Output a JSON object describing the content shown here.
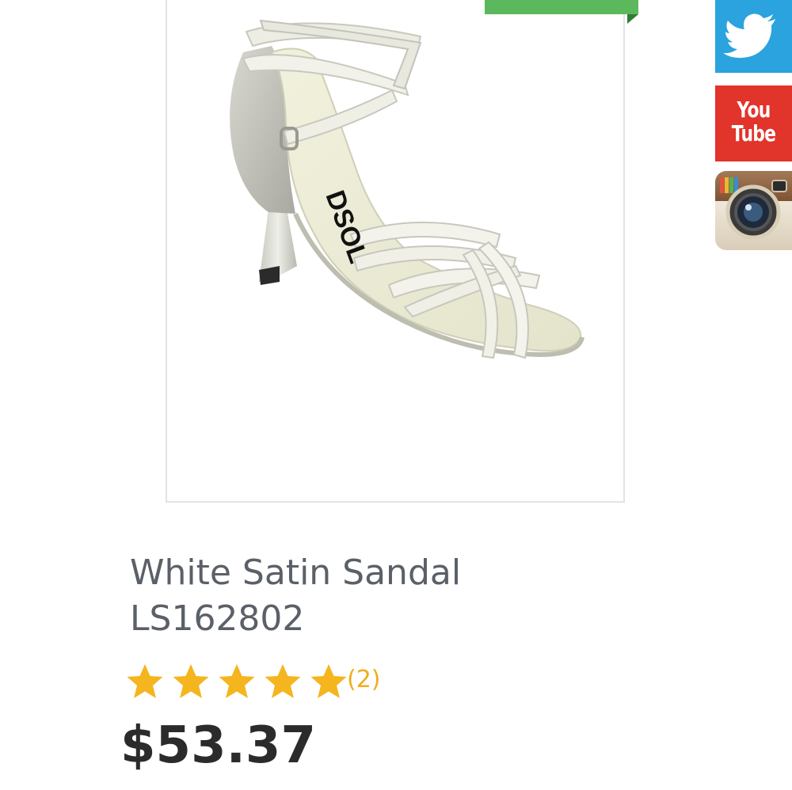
{
  "product": {
    "title_line1": "White Satin Sandal",
    "title_line2": "LS162802",
    "image_logo": "DSOL",
    "rating": {
      "stars": 5,
      "max": 5,
      "review_count": "(2)"
    },
    "price": "$53.37"
  },
  "social": {
    "twitter": {
      "icon": "twitter-bird-icon",
      "color": "#2aa3de"
    },
    "youtube": {
      "label_you": "You",
      "label_tube": "Tube",
      "color": "#e1342a"
    },
    "instagram": {
      "icon": "instagram-camera-icon"
    }
  },
  "colors": {
    "title": "#5b6068",
    "price": "#2b2b2b",
    "star": "#f5b51e",
    "promo_ribbon": "#5cb85c"
  }
}
